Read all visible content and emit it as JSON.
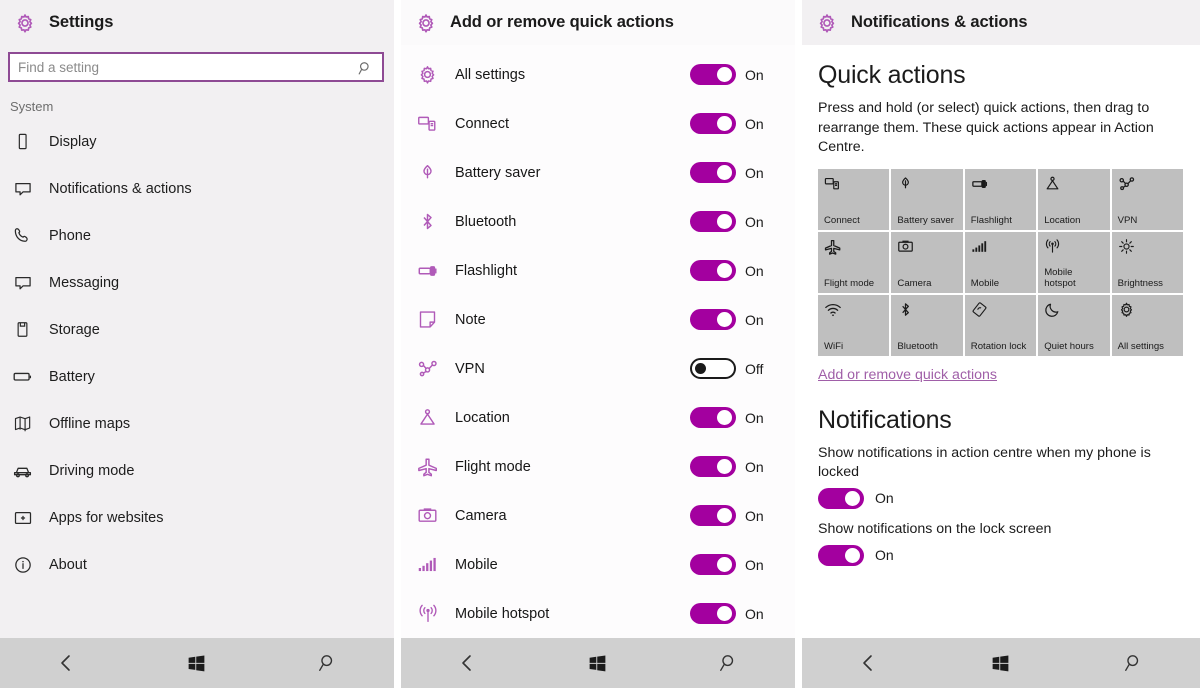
{
  "left_panel": {
    "title": "Settings",
    "title_icon": "gear-icon",
    "search": {
      "placeholder": "Find a setting",
      "value": "",
      "icon": "search-icon"
    },
    "group_label": "System",
    "items": [
      {
        "label": "Display",
        "icon": "phone-display-icon"
      },
      {
        "label": "Notifications & actions",
        "icon": "speech-bubble-icon"
      },
      {
        "label": "Phone",
        "icon": "phone-handset-icon"
      },
      {
        "label": "Messaging",
        "icon": "message-icon"
      },
      {
        "label": "Storage",
        "icon": "storage-icon"
      },
      {
        "label": "Battery",
        "icon": "battery-icon"
      },
      {
        "label": "Offline maps",
        "icon": "map-icon"
      },
      {
        "label": "Driving mode",
        "icon": "car-icon"
      },
      {
        "label": "Apps for websites",
        "icon": "apps-websites-icon"
      },
      {
        "label": "About",
        "icon": "info-icon"
      }
    ]
  },
  "mid_panel": {
    "title": "Add or remove quick actions",
    "title_icon": "gear-icon",
    "rows": [
      {
        "label": "All settings",
        "icon": "gear-icon",
        "state": "On",
        "on": true
      },
      {
        "label": "Connect",
        "icon": "connect-icon",
        "state": "On",
        "on": true
      },
      {
        "label": "Battery saver",
        "icon": "battery-saver-icon",
        "state": "On",
        "on": true
      },
      {
        "label": "Bluetooth",
        "icon": "bluetooth-icon",
        "state": "On",
        "on": true
      },
      {
        "label": "Flashlight",
        "icon": "flashlight-icon",
        "state": "On",
        "on": true
      },
      {
        "label": "Note",
        "icon": "note-icon",
        "state": "On",
        "on": true
      },
      {
        "label": "VPN",
        "icon": "vpn-icon",
        "state": "Off",
        "on": false
      },
      {
        "label": "Location",
        "icon": "location-icon",
        "state": "On",
        "on": true
      },
      {
        "label": "Flight mode",
        "icon": "flight-mode-icon",
        "state": "On",
        "on": true
      },
      {
        "label": "Camera",
        "icon": "camera-icon",
        "state": "On",
        "on": true
      },
      {
        "label": "Mobile",
        "icon": "signal-bars-icon",
        "state": "On",
        "on": true
      },
      {
        "label": "Mobile hotspot",
        "icon": "hotspot-icon",
        "state": "On",
        "on": true
      }
    ]
  },
  "right_panel": {
    "title": "Notifications & actions",
    "title_icon": "gear-icon",
    "quick_actions": {
      "heading": "Quick actions",
      "description": "Press and hold (or select) quick actions, then drag to rearrange them. These quick actions appear in Action Centre.",
      "tiles": [
        {
          "label": "Connect",
          "icon": "connect-icon"
        },
        {
          "label": "Battery saver",
          "icon": "battery-saver-icon"
        },
        {
          "label": "Flashlight",
          "icon": "flashlight-icon"
        },
        {
          "label": "Location",
          "icon": "location-icon"
        },
        {
          "label": "VPN",
          "icon": "vpn-icon"
        },
        {
          "label": "Flight mode",
          "icon": "flight-mode-icon"
        },
        {
          "label": "Camera",
          "icon": "camera-icon"
        },
        {
          "label": "Mobile",
          "icon": "signal-bars-icon"
        },
        {
          "label": "Mobile hotspot",
          "icon": "hotspot-icon"
        },
        {
          "label": "Brightness",
          "icon": "brightness-icon"
        },
        {
          "label": "WiFi",
          "icon": "wifi-icon"
        },
        {
          "label": "Bluetooth",
          "icon": "bluetooth-icon"
        },
        {
          "label": "Rotation lock",
          "icon": "rotation-lock-icon"
        },
        {
          "label": "Quiet hours",
          "icon": "moon-icon"
        },
        {
          "label": "All settings",
          "icon": "gear-icon"
        }
      ],
      "link_label": "Add or remove quick actions"
    },
    "notifications": {
      "heading": "Notifications",
      "rows": [
        {
          "text": "Show notifications in action centre when my phone is locked",
          "state": "On",
          "on": true
        },
        {
          "text": "Show notifications on the lock screen",
          "state": "On",
          "on": true
        }
      ]
    }
  },
  "navbar": {
    "back": "back-arrow-icon",
    "home": "windows-icon",
    "search": "search-icon"
  },
  "colors": {
    "accent_purple": "#a3009f",
    "icon_purple": "#b05ab8",
    "link_purple": "#a05fa8",
    "tile_grey": "#bfbfbf",
    "navbar_grey": "#d0d0d0",
    "panel_grey": "#f2f0f2"
  }
}
